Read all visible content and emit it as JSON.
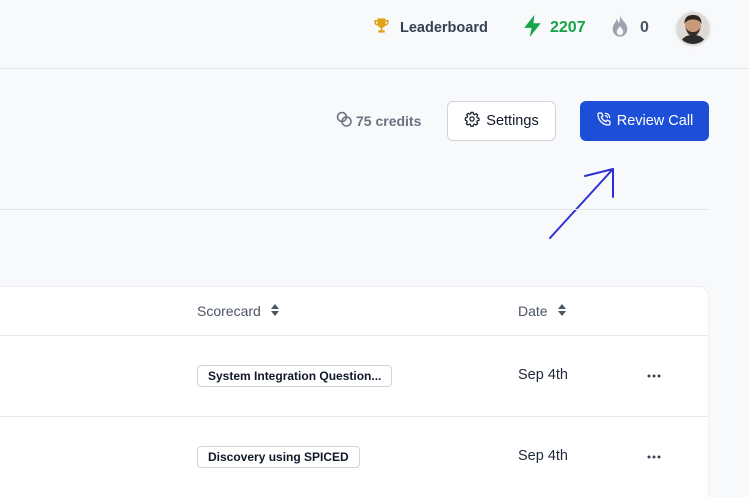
{
  "header": {
    "leaderboard_label": "Leaderboard",
    "points": "2207",
    "streak": "0"
  },
  "toolbar": {
    "credits": "75 credits",
    "settings_label": "Settings",
    "review_call_label": "Review Call"
  },
  "table": {
    "columns": [
      "Scorecard",
      "Date"
    ],
    "rows": [
      {
        "scorecard": "System Integration Question...",
        "date": "Sep 4th"
      },
      {
        "scorecard": "Discovery using SPICED",
        "date": "Sep 4th"
      }
    ]
  },
  "colors": {
    "primary": "#1d4ed8",
    "points": "#16a34a",
    "trophy": "#e0a21a",
    "annotation_arrow": "#2f2fd6"
  }
}
